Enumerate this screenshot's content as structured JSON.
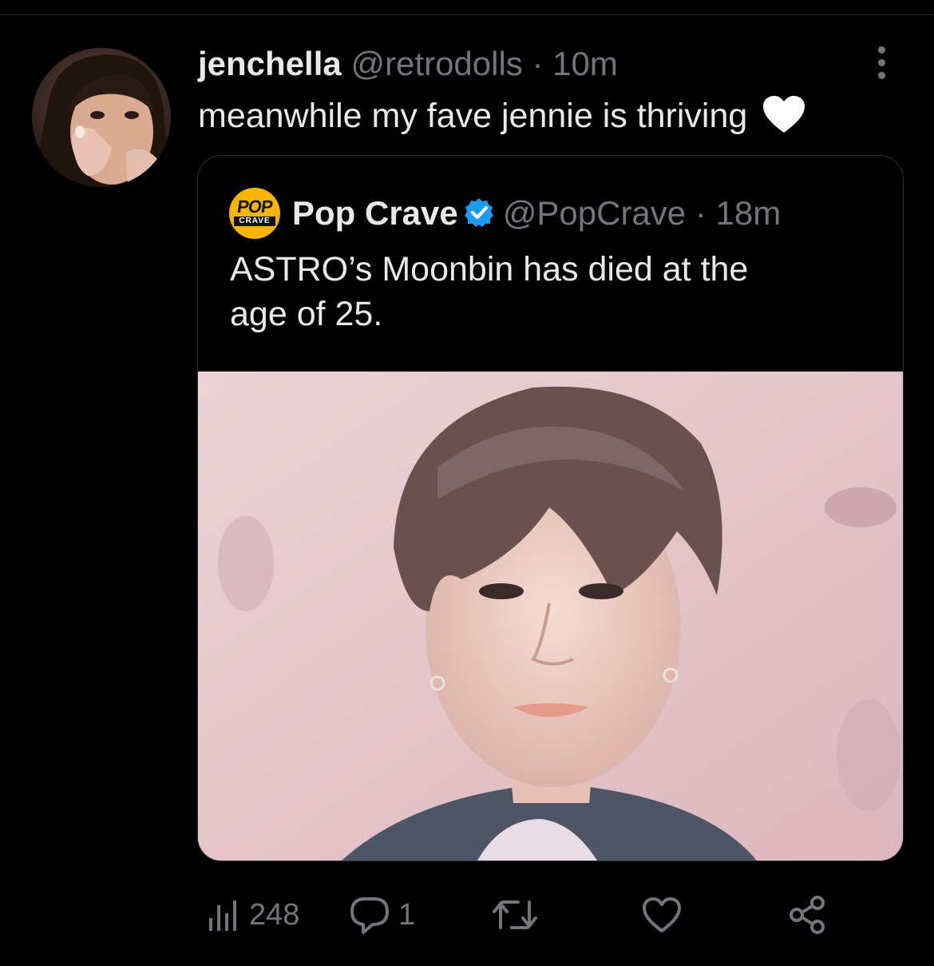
{
  "tweet": {
    "display_name": "jenchella",
    "handle": "@retrodolls",
    "separator": "·",
    "time": "10m",
    "text": "meanwhile my fave jennie is thriving",
    "emoji": "white-heart"
  },
  "quoted_tweet": {
    "avatar_logo": {
      "top": "POP",
      "bottom": "CRAVE"
    },
    "display_name": "Pop Crave",
    "verified": true,
    "handle": "@PopCrave",
    "separator": "·",
    "time": "18m",
    "text_lines": [
      "ASTRO’s Moonbin has died at the",
      "age of 25."
    ],
    "media": "photo-portrait"
  },
  "actions": {
    "views": "248",
    "replies": "1",
    "retweets": "",
    "likes": ""
  },
  "icons": {
    "more": "more-vertical-icon",
    "views": "bar-chart-icon",
    "reply": "speech-bubble-icon",
    "retweet": "retweet-icon",
    "like": "heart-outline-icon",
    "share": "share-nodes-icon",
    "verified": "verified-badge-icon"
  },
  "colors": {
    "background": "#000000",
    "text_primary": "#e7e9ea",
    "text_secondary": "#71767b",
    "verified_blue": "#1d9bf0",
    "border": "#2f3336"
  }
}
